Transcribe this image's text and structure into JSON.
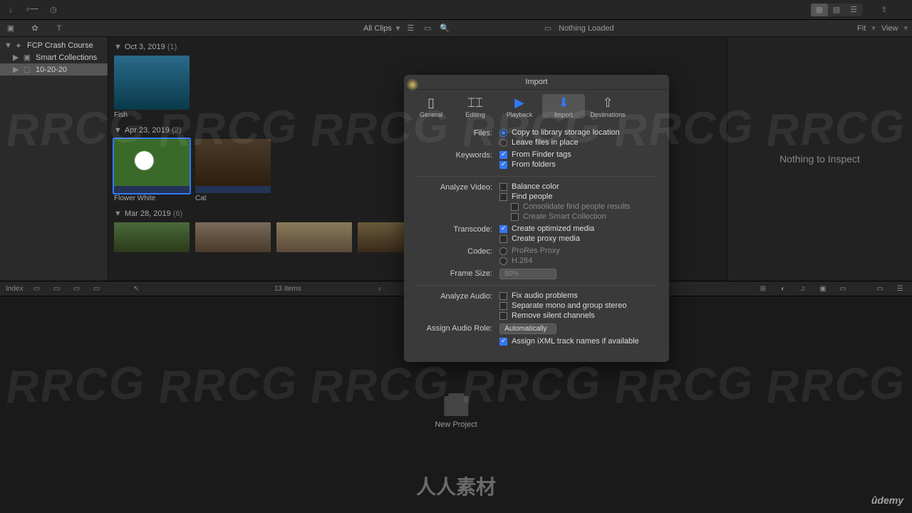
{
  "topbar": {
    "import_icon": "import",
    "key_icon": "key",
    "clock_icon": "clock"
  },
  "toolbar2": {
    "clips_dropdown": "All Clips",
    "viewer_title": "Nothing Loaded",
    "fit": "Fit",
    "view": "View"
  },
  "sidebar": {
    "items": [
      {
        "label": "FCP Crash Course",
        "type": "library"
      },
      {
        "label": "Smart Collections",
        "type": "folder"
      },
      {
        "label": "10-20-20",
        "type": "event"
      }
    ]
  },
  "browser": {
    "groups": [
      {
        "date": "Oct 3, 2019",
        "count": "(1)",
        "clips": [
          {
            "label": "Fish",
            "art": "art-fish"
          }
        ]
      },
      {
        "date": "Apr 23, 2019",
        "count": "(2)",
        "clips": [
          {
            "label": "Flower White",
            "art": "art-flower",
            "sel": true
          },
          {
            "label": "Cat",
            "art": "art-cat"
          }
        ]
      },
      {
        "date": "Mar 28, 2019",
        "count": "(6)",
        "clips": [
          {
            "label": "",
            "art": "art-bird"
          },
          {
            "label": "",
            "art": "art-person"
          },
          {
            "label": "",
            "art": "art-deer"
          },
          {
            "label": "",
            "art": "art-fish2"
          }
        ]
      }
    ],
    "items_label": "13 items"
  },
  "inspector": {
    "empty": "Nothing to Inspect"
  },
  "timeline": {
    "index": "Index",
    "new_project": "New Project"
  },
  "dialog": {
    "title": "Import",
    "tabs": [
      {
        "label": "General"
      },
      {
        "label": "Editing"
      },
      {
        "label": "Playback"
      },
      {
        "label": "Import",
        "sel": true
      },
      {
        "label": "Destinations"
      }
    ],
    "files_label": "Files:",
    "files_opt1": "Copy to library storage location",
    "files_opt2": "Leave files in place",
    "keywords_label": "Keywords:",
    "keywords_opt1": "From Finder tags",
    "keywords_opt2": "From folders",
    "analyze_video_label": "Analyze Video:",
    "av_opt1": "Balance color",
    "av_opt2": "Find people",
    "av_opt3": "Consolidate find people results",
    "av_opt4": "Create Smart Collection",
    "transcode_label": "Transcode:",
    "tc_opt1": "Create optimized media",
    "tc_opt2": "Create proxy media",
    "codec_label": "Codec:",
    "codec_opt1": "ProRes Proxy",
    "codec_opt2": "H.264",
    "framesize_label": "Frame Size:",
    "framesize_value": "50%",
    "analyze_audio_label": "Analyze Audio:",
    "aa_opt1": "Fix audio problems",
    "aa_opt2": "Separate mono and group stereo",
    "aa_opt3": "Remove silent channels",
    "assign_role_label": "Assign Audio Role:",
    "assign_role_value": "Automatically",
    "assign_ixml": "Assign iXML track names if available"
  },
  "watermark": {
    "text": "RRCG",
    "logo": "人人素材",
    "udemy": "ûdemy"
  }
}
